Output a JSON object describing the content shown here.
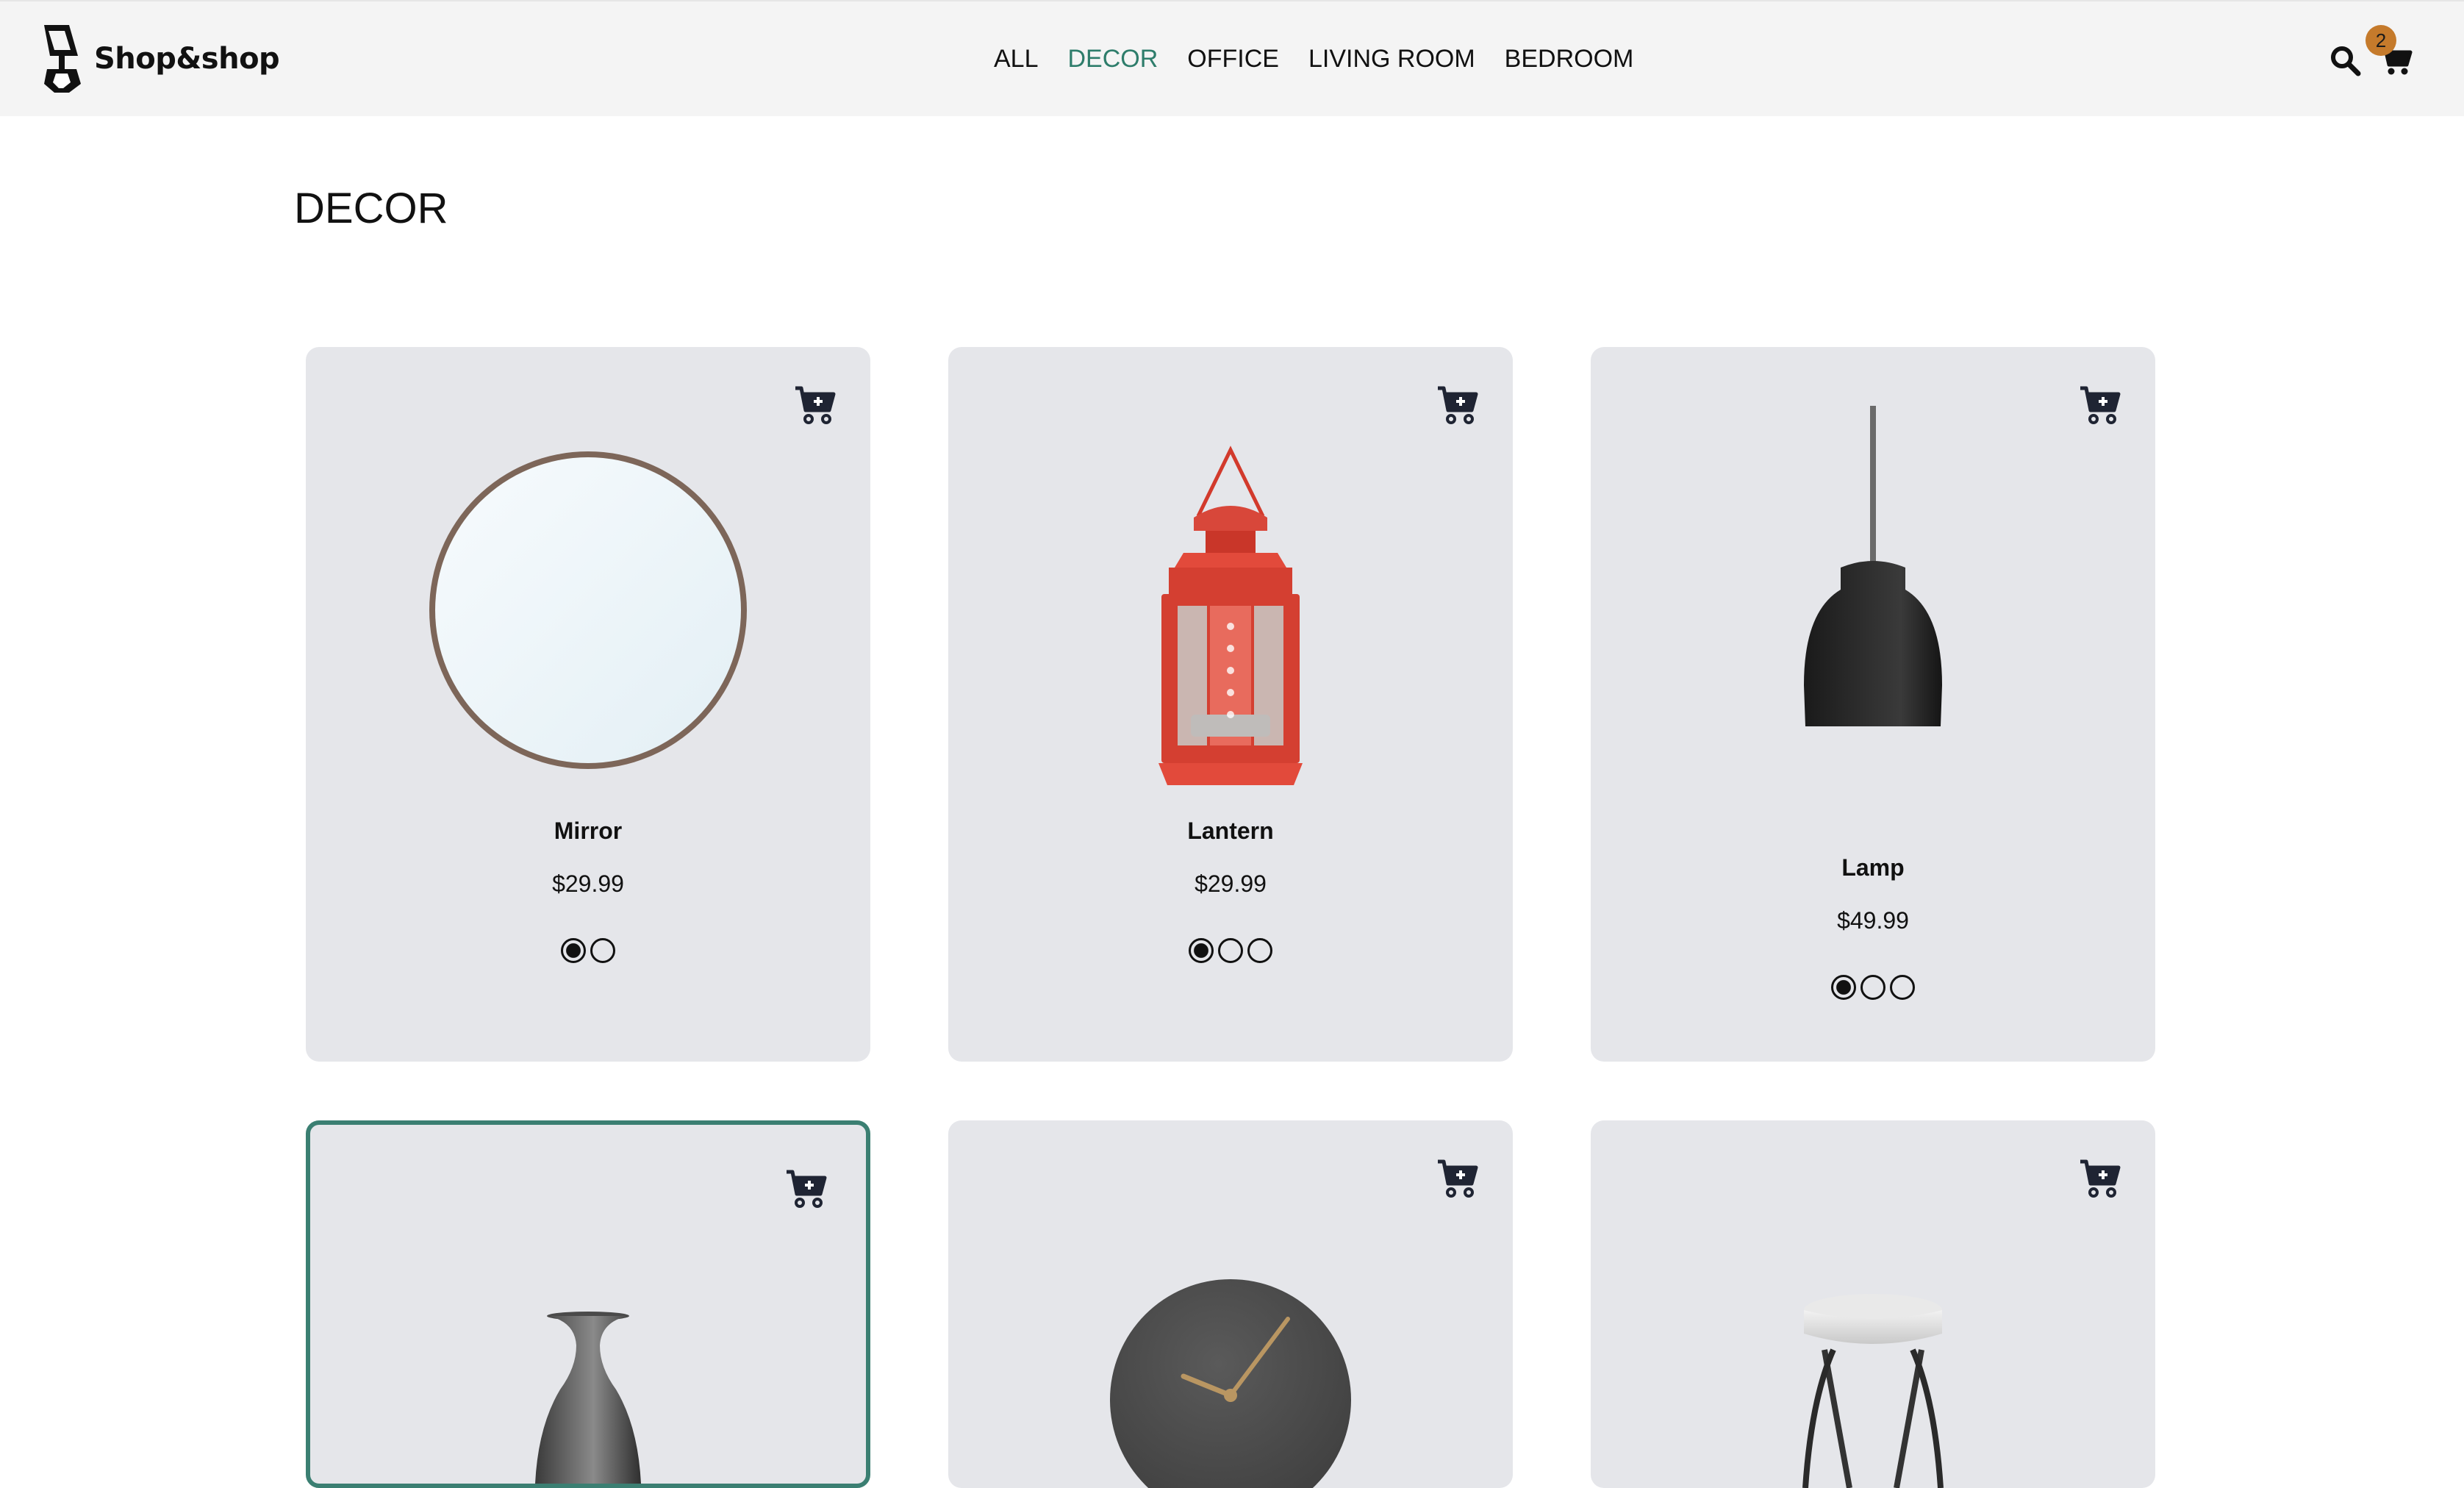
{
  "header": {
    "brand": "Shop&shop",
    "nav": [
      {
        "label": "ALL",
        "active": false
      },
      {
        "label": "DECOR",
        "active": true
      },
      {
        "label": "OFFICE",
        "active": false
      },
      {
        "label": "LIVING ROOM",
        "active": false
      },
      {
        "label": "BEDROOM",
        "active": false
      }
    ],
    "cart_count": "2",
    "icons": {
      "search": "search-icon",
      "cart": "cart-icon"
    },
    "accent_color": "#2e7d6b",
    "badge_color": "#c57a2b"
  },
  "page": {
    "title": "DECOR"
  },
  "products": [
    {
      "name": "Mirror",
      "price": "$29.99",
      "swatch_count": 2,
      "selected_swatch": 0
    },
    {
      "name": "Lantern",
      "price": "$29.99",
      "swatch_count": 3,
      "selected_swatch": 0
    },
    {
      "name": "Lamp",
      "price": "$49.99",
      "swatch_count": 3,
      "selected_swatch": 0
    },
    {
      "name": "Vase",
      "selected": true
    },
    {
      "name": "Clock"
    },
    {
      "name": "Stool"
    }
  ]
}
